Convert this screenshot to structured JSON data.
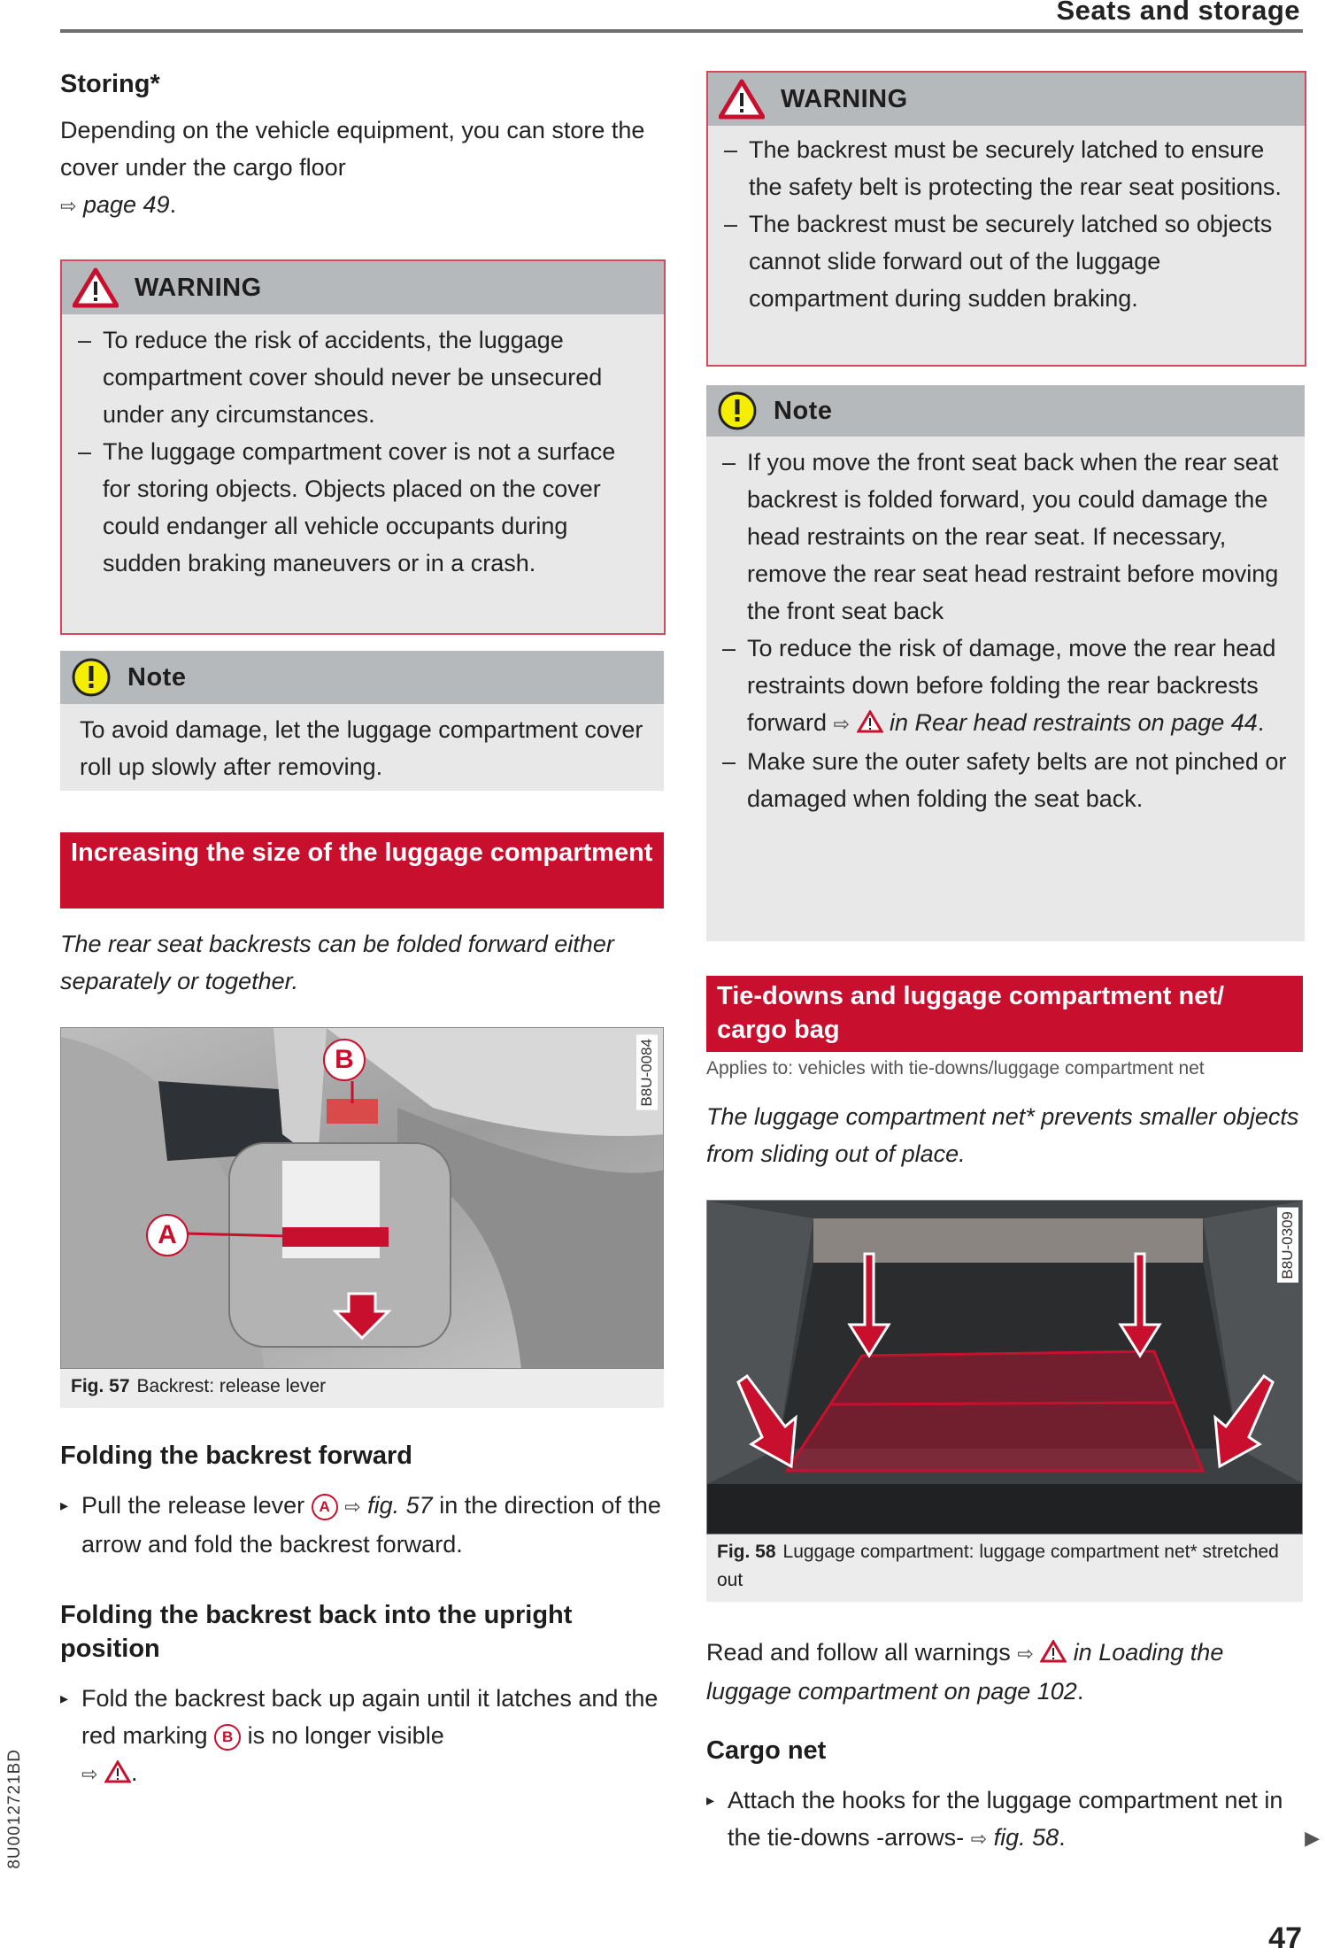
{
  "header": {
    "section_title": "Seats and storage"
  },
  "left": {
    "storing": {
      "title": "Storing*",
      "text": "Depending on the vehicle equipment, you can store the cover under the cargo floor",
      "xref": "page 49",
      "xref_suffix": "."
    },
    "warning": {
      "label": "WARNING",
      "items": [
        "To reduce the risk of accidents, the luggage compartment cover should never be unsecured under any circumstances.",
        "The luggage compartment cover is not a surface for storing objects. Objects placed on the cover could endanger all vehicle occupants during sudden braking maneuvers or in a crash."
      ]
    },
    "note": {
      "label": "Note",
      "text": "To avoid damage, let the luggage compartment cover roll up slowly after removing."
    },
    "section": {
      "title": "Increasing the size of the luggage compartment",
      "intro": "The rear seat backrests can be folded forward either separately or together."
    },
    "figure": {
      "code": "B8U-0084",
      "fig_no": "Fig. 57",
      "caption": "Backrest: release lever",
      "callouts": [
        "A",
        "B"
      ]
    },
    "fold_forward": {
      "title": "Folding the backrest forward",
      "step_pre": "Pull the release lever",
      "step_marker": "A",
      "step_xref": "fig. 57",
      "step_post": "in the direction of the arrow and fold the backrest forward."
    },
    "fold_back": {
      "title": "Folding the backrest back into the upright position",
      "step_pre": "Fold the backrest back up again until it latches and the red marking",
      "step_marker": "B",
      "step_post": "is no longer visible",
      "step_end": "."
    }
  },
  "right": {
    "warning": {
      "label": "WARNING",
      "items": [
        "The backrest must be securely latched to ensure the safety belt is protecting the rear seat positions.",
        "The backrest must be securely latched so objects cannot slide forward out of the luggage compartment during sudden braking."
      ]
    },
    "note": {
      "label": "Note",
      "items": [
        {
          "text": "If you move the front seat back when the rear seat backrest is folded forward, you could damage the head restraints on the rear seat. If necessary, remove the rear seat head restraint before moving the front seat back"
        },
        {
          "text": "To reduce the risk of damage, move the rear head restraints down before folding the rear backrests forward",
          "xref": "in Rear head restraints on page 44",
          "xref_suffix": "."
        },
        {
          "text": "Make sure the outer safety belts are not pinched or damaged when folding the seat back."
        }
      ]
    },
    "section": {
      "title": "Tie-downs and luggage compartment net/ cargo bag",
      "applies": "Applies to: vehicles with tie-downs/luggage compartment net",
      "intro": "The luggage compartment net* prevents smaller objects from sliding out of place."
    },
    "figure": {
      "code": "B8U-0309",
      "fig_no": "Fig. 58",
      "caption": "Luggage compartment: luggage compartment net* stretched out"
    },
    "read_follow": {
      "text": "Read and follow all warnings",
      "xref": "in Loading the luggage compartment on page 102",
      "xref_suffix": "."
    },
    "cargo_net": {
      "title": "Cargo net",
      "step_pre": "Attach the hooks for the luggage compartment net in the tie-downs -arrows-",
      "step_xref": "fig. 58",
      "step_end": "."
    }
  },
  "footer": {
    "page_number": "47",
    "doc_code": "8U0012721BD",
    "continue_icon": "triangle-right"
  },
  "glyphs": {
    "xref_arrow": "⇨",
    "step_bullet": "▸",
    "continue": "▶"
  },
  "colors": {
    "accent_red": "#c8102e",
    "box_grey": "#e8e8e8",
    "box_head_grey": "#b6b9bb",
    "note_yellow": "#f5ee00"
  }
}
